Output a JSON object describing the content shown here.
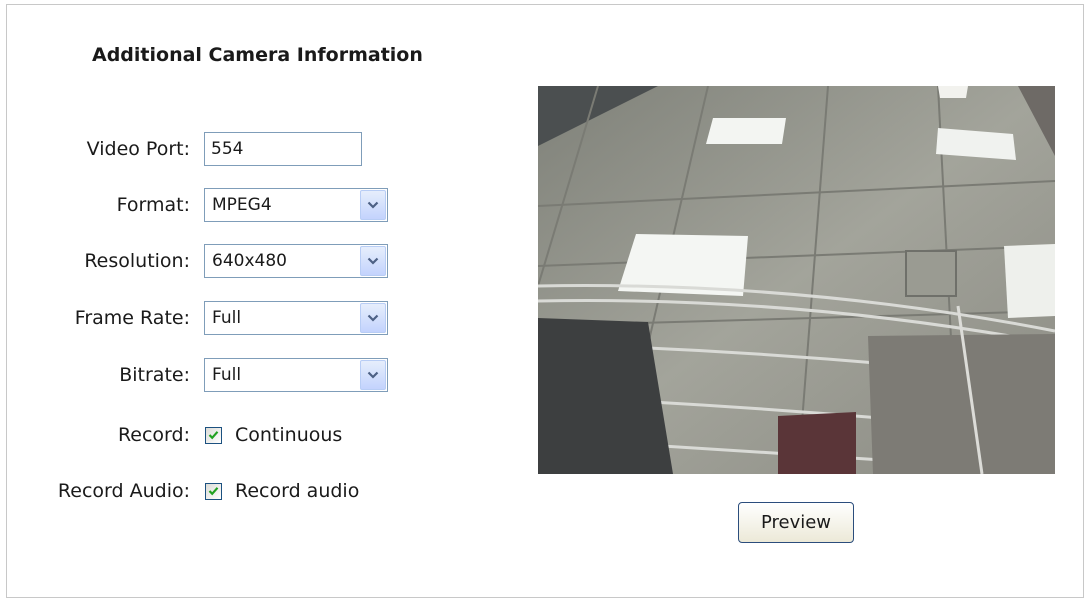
{
  "section": {
    "title": "Additional Camera Information"
  },
  "fields": {
    "video_port": {
      "label": "Video Port:",
      "value": "554"
    },
    "format": {
      "label": "Format:",
      "value": "MPEG4"
    },
    "resolution": {
      "label": "Resolution:",
      "value": "640x480"
    },
    "frame_rate": {
      "label": "Frame Rate:",
      "value": "Full"
    },
    "bitrate": {
      "label": "Bitrate:",
      "value": "Full"
    },
    "record": {
      "label": "Record:",
      "option_label": "Continuous",
      "checked": true
    },
    "record_audio": {
      "label": "Record Audio:",
      "option_label": "Record audio",
      "checked": true
    }
  },
  "preview": {
    "button_label": "Preview",
    "image_icon": "camera-preview-image"
  },
  "colors": {
    "check_mark": "#21a121",
    "dropdown_arrow": "#4d6185",
    "input_border": "#7f9db9"
  }
}
